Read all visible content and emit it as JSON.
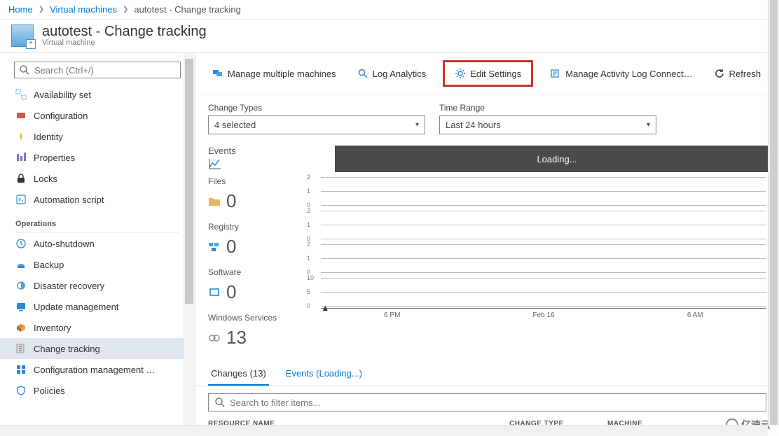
{
  "breadcrumb": {
    "home": "Home",
    "vms": "Virtual machines",
    "current": "autotest - Change tracking"
  },
  "header": {
    "title": "autotest - Change tracking",
    "subtitle": "Virtual machine"
  },
  "sidebar": {
    "search_placeholder": "Search (Ctrl+/)",
    "items_top": [
      {
        "label": "Availability set",
        "icon": "availability-set-icon"
      },
      {
        "label": "Configuration",
        "icon": "configuration-icon"
      },
      {
        "label": "Identity",
        "icon": "identity-icon"
      },
      {
        "label": "Properties",
        "icon": "properties-icon"
      },
      {
        "label": "Locks",
        "icon": "locks-icon"
      },
      {
        "label": "Automation script",
        "icon": "automation-script-icon"
      }
    ],
    "group_label": "Operations",
    "items_ops": [
      {
        "label": "Auto-shutdown",
        "icon": "auto-shutdown-icon"
      },
      {
        "label": "Backup",
        "icon": "backup-icon"
      },
      {
        "label": "Disaster recovery",
        "icon": "disaster-recovery-icon"
      },
      {
        "label": "Update management",
        "icon": "update-management-icon"
      },
      {
        "label": "Inventory",
        "icon": "inventory-icon"
      },
      {
        "label": "Change tracking",
        "icon": "change-tracking-icon",
        "selected": true
      },
      {
        "label": "Configuration management …",
        "icon": "config-mgmt-icon"
      },
      {
        "label": "Policies",
        "icon": "policies-icon"
      }
    ]
  },
  "toolbar": {
    "manage_multi": "Manage multiple machines",
    "log_analytics": "Log Analytics",
    "edit_settings": "Edit Settings",
    "manage_activity": "Manage Activity Log Connect…",
    "refresh": "Refresh"
  },
  "filters": {
    "change_types_label": "Change Types",
    "change_types_value": "4 selected",
    "time_range_label": "Time Range",
    "time_range_value": "Last 24 hours"
  },
  "events": {
    "title": "Events",
    "loading": "Loading...",
    "rows": [
      {
        "label": "Files",
        "count": "0"
      },
      {
        "label": "Registry",
        "count": "0"
      },
      {
        "label": "Software",
        "count": "0"
      },
      {
        "label": "Windows Services",
        "count": "13"
      }
    ]
  },
  "chart_data": [
    {
      "type": "bar",
      "title": "Files",
      "yticks": [
        0,
        1,
        2
      ],
      "values": [],
      "xticks": [
        "6 PM",
        "Feb 16",
        "6 AM"
      ]
    },
    {
      "type": "bar",
      "title": "Registry",
      "yticks": [
        0,
        1,
        2
      ],
      "values": [],
      "xticks": [
        "6 PM",
        "Feb 16",
        "6 AM"
      ]
    },
    {
      "type": "bar",
      "title": "Software",
      "yticks": [
        0,
        1,
        2
      ],
      "values": [],
      "xticks": [
        "6 PM",
        "Feb 16",
        "6 AM"
      ]
    },
    {
      "type": "bar",
      "title": "Windows Services",
      "yticks": [
        0,
        5,
        10
      ],
      "values": [],
      "xticks": [
        "6 PM",
        "Feb 16",
        "6 AM"
      ]
    }
  ],
  "x_axis": {
    "ticks": [
      "6 PM",
      "Feb 16",
      "6 AM"
    ]
  },
  "tabs": {
    "changes": "Changes (13)",
    "events": "Events (Loading...)"
  },
  "table": {
    "search_placeholder": "Search to filter items...",
    "headers": {
      "name": "RESOURCE NAME",
      "type": "CHANGE TYPE",
      "machine": "MACHINE"
    }
  },
  "watermark": "亿速云"
}
